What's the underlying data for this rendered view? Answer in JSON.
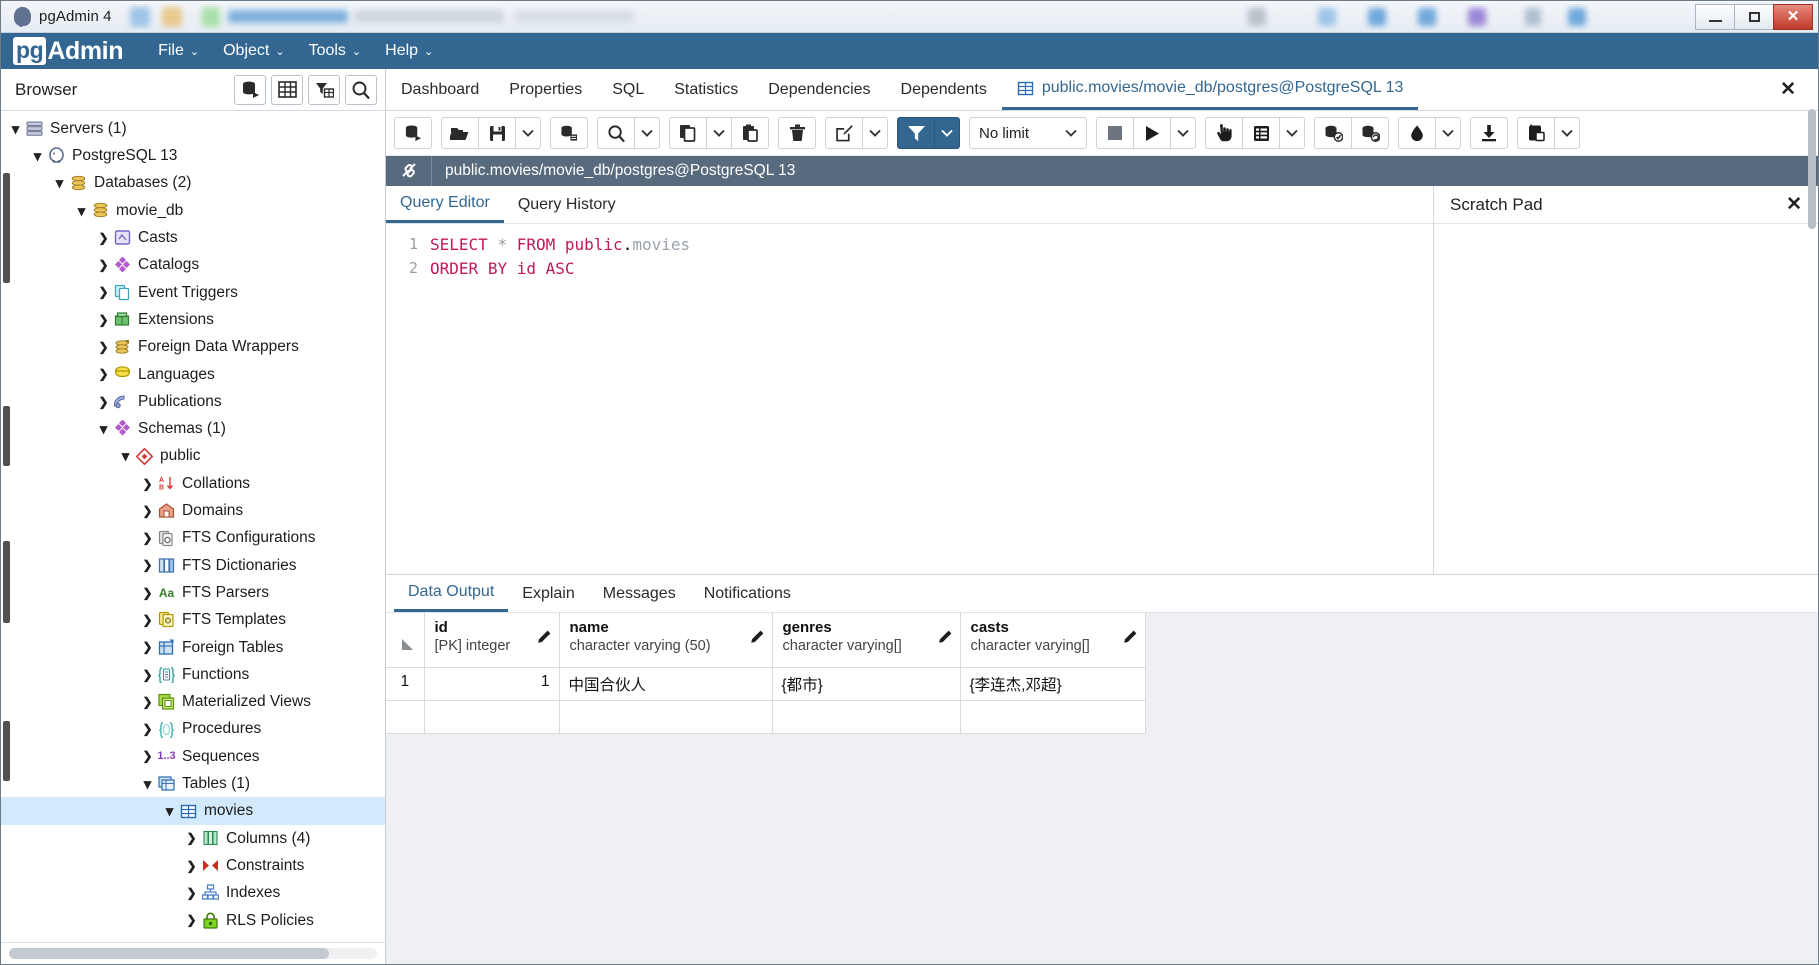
{
  "window": {
    "title": "pgAdmin 4",
    "app_icon": "postgres-elephant-icon",
    "controls": {
      "minimize": "minimize-icon",
      "maximize": "maximize-icon",
      "close": "✕"
    }
  },
  "menubar": {
    "brand_pg": "pg",
    "brand_admin": "Admin",
    "items": [
      {
        "label": "File",
        "caret": "⌄"
      },
      {
        "label": "Object",
        "caret": "⌄"
      },
      {
        "label": "Tools",
        "caret": "⌄"
      },
      {
        "label": "Help",
        "caret": "⌄"
      }
    ]
  },
  "browser": {
    "title": "Browser",
    "header_buttons": [
      {
        "name": "object-explorer-button",
        "icon": "database-run-icon"
      },
      {
        "name": "grid-view-button",
        "icon": "table-icon"
      },
      {
        "name": "filtered-rows-button",
        "icon": "filter-table-icon"
      },
      {
        "name": "search-objects-button",
        "icon": "search-icon"
      }
    ],
    "tree": [
      {
        "label": "Servers (1)",
        "indent": 0,
        "state": "down",
        "icon": "servers-icon",
        "selected": false
      },
      {
        "label": "PostgreSQL 13",
        "indent": 1,
        "state": "down",
        "icon": "postgres-icon",
        "selected": false
      },
      {
        "label": "Databases (2)",
        "indent": 2,
        "state": "down",
        "icon": "databases-icon",
        "selected": false
      },
      {
        "label": "movie_db",
        "indent": 3,
        "state": "down",
        "icon": "database-icon",
        "selected": false
      },
      {
        "label": "Casts",
        "indent": 4,
        "state": "right",
        "icon": "casts-icon",
        "selected": false
      },
      {
        "label": "Catalogs",
        "indent": 4,
        "state": "right",
        "icon": "catalogs-icon",
        "selected": false
      },
      {
        "label": "Event Triggers",
        "indent": 4,
        "state": "right",
        "icon": "event-triggers-icon",
        "selected": false
      },
      {
        "label": "Extensions",
        "indent": 4,
        "state": "right",
        "icon": "extensions-icon",
        "selected": false
      },
      {
        "label": "Foreign Data Wrappers",
        "indent": 4,
        "state": "right",
        "icon": "fdw-icon",
        "selected": false
      },
      {
        "label": "Languages",
        "indent": 4,
        "state": "right",
        "icon": "languages-icon",
        "selected": false
      },
      {
        "label": "Publications",
        "indent": 4,
        "state": "right",
        "icon": "publications-icon",
        "selected": false
      },
      {
        "label": "Schemas (1)",
        "indent": 4,
        "state": "down",
        "icon": "schemas-icon",
        "selected": false
      },
      {
        "label": "public",
        "indent": 5,
        "state": "down",
        "icon": "schema-icon",
        "selected": false
      },
      {
        "label": "Collations",
        "indent": 6,
        "state": "right",
        "icon": "collations-icon",
        "selected": false
      },
      {
        "label": "Domains",
        "indent": 6,
        "state": "right",
        "icon": "domains-icon",
        "selected": false
      },
      {
        "label": "FTS Configurations",
        "indent": 6,
        "state": "right",
        "icon": "fts-config-icon",
        "selected": false
      },
      {
        "label": "FTS Dictionaries",
        "indent": 6,
        "state": "right",
        "icon": "fts-dict-icon",
        "selected": false
      },
      {
        "label": "FTS Parsers",
        "indent": 6,
        "state": "right",
        "icon": "fts-parsers-icon",
        "selected": false
      },
      {
        "label": "FTS Templates",
        "indent": 6,
        "state": "right",
        "icon": "fts-templates-icon",
        "selected": false
      },
      {
        "label": "Foreign Tables",
        "indent": 6,
        "state": "right",
        "icon": "foreign-tables-icon",
        "selected": false
      },
      {
        "label": "Functions",
        "indent": 6,
        "state": "right",
        "icon": "functions-icon",
        "selected": false
      },
      {
        "label": "Materialized Views",
        "indent": 6,
        "state": "right",
        "icon": "matviews-icon",
        "selected": false
      },
      {
        "label": "Procedures",
        "indent": 6,
        "state": "right",
        "icon": "procedures-icon",
        "selected": false
      },
      {
        "label": "Sequences",
        "indent": 6,
        "state": "right",
        "icon": "sequences-icon",
        "selected": false
      },
      {
        "label": "Tables (1)",
        "indent": 6,
        "state": "down",
        "icon": "tables-icon",
        "selected": false
      },
      {
        "label": "movies",
        "indent": 7,
        "state": "down",
        "icon": "table-icon",
        "selected": true
      },
      {
        "label": "Columns (4)",
        "indent": 8,
        "state": "right",
        "icon": "columns-icon",
        "selected": false
      },
      {
        "label": "Constraints",
        "indent": 8,
        "state": "right",
        "icon": "constraints-icon",
        "selected": false
      },
      {
        "label": "Indexes",
        "indent": 8,
        "state": "right",
        "icon": "indexes-icon",
        "selected": false
      },
      {
        "label": "RLS Policies",
        "indent": 8,
        "state": "right",
        "icon": "rls-policies-icon",
        "selected": false
      }
    ]
  },
  "main_tabs": [
    {
      "label": "Dashboard",
      "active": false,
      "icon": null
    },
    {
      "label": "Properties",
      "active": false,
      "icon": null
    },
    {
      "label": "SQL",
      "active": false,
      "icon": null
    },
    {
      "label": "Statistics",
      "active": false,
      "icon": null
    },
    {
      "label": "Dependencies",
      "active": false,
      "icon": null
    },
    {
      "label": "Dependents",
      "active": false,
      "icon": null
    },
    {
      "label": "public.movies/movie_db/postgres@PostgreSQL 13",
      "active": true,
      "icon": "table-icon"
    }
  ],
  "tab_close_label": "✕",
  "query_toolbar": {
    "groups": [
      [
        {
          "name": "open-new-query-tool-button",
          "icon": "database-run-icon",
          "caret": false
        }
      ],
      [
        {
          "name": "open-file-button",
          "icon": "folder-open-icon",
          "caret": false
        },
        {
          "name": "save-file-button",
          "icon": "save-icon",
          "caret": false
        },
        {
          "name": "save-file-menu-button",
          "icon": "chevron-down-icon",
          "caret": true
        }
      ],
      [
        {
          "name": "edit-data-button",
          "icon": "database-edit-icon",
          "caret": false
        }
      ],
      [
        {
          "name": "find-button",
          "icon": "search-icon",
          "caret": false
        },
        {
          "name": "find-menu-button",
          "icon": "chevron-down-icon",
          "caret": true
        }
      ],
      [
        {
          "name": "copy-button",
          "icon": "copy-icon",
          "caret": false
        },
        {
          "name": "copy-menu-button",
          "icon": "chevron-down-icon",
          "caret": true
        },
        {
          "name": "paste-button",
          "icon": "paste-icon",
          "caret": false
        }
      ],
      [
        {
          "name": "delete-row-button",
          "icon": "trash-icon",
          "caret": false
        }
      ],
      [
        {
          "name": "edit-menu-button",
          "icon": "pencil-square-icon",
          "caret": false
        },
        {
          "name": "edit-menu-caret-button",
          "icon": "chevron-down-icon",
          "caret": true
        }
      ],
      [
        {
          "name": "filter-button",
          "icon": "filter-icon",
          "caret": false,
          "accent": true
        },
        {
          "name": "filter-menu-button",
          "icon": "chevron-down-icon",
          "caret": true,
          "accent": true
        }
      ]
    ],
    "row_limit": {
      "value": "No limit",
      "caret": "⌄"
    },
    "exec_groups": [
      [
        {
          "name": "stop-query-button",
          "icon": "stop-square-icon",
          "caret": false
        },
        {
          "name": "execute-query-button",
          "icon": "play-icon",
          "caret": false
        },
        {
          "name": "execute-menu-button",
          "icon": "chevron-down-icon",
          "caret": true
        }
      ],
      [
        {
          "name": "explain-button",
          "icon": "hand-pointer-icon",
          "caret": false
        },
        {
          "name": "explain-analyze-button",
          "icon": "list-icon",
          "caret": false
        },
        {
          "name": "explain-options-button",
          "icon": "chevron-down-icon",
          "caret": true
        }
      ],
      [
        {
          "name": "commit-button",
          "icon": "commit-icon",
          "caret": false
        },
        {
          "name": "rollback-button",
          "icon": "rollback-icon",
          "caret": false
        }
      ],
      [
        {
          "name": "clear-button",
          "icon": "eraser-icon",
          "caret": false
        },
        {
          "name": "clear-menu-button",
          "icon": "chevron-down-icon",
          "caret": true
        }
      ],
      [
        {
          "name": "download-csv-button",
          "icon": "download-icon",
          "caret": false
        }
      ],
      [
        {
          "name": "macros-button",
          "icon": "macro-icon",
          "caret": false
        },
        {
          "name": "macros-menu-button",
          "icon": "chevron-down-icon",
          "caret": true
        }
      ]
    ]
  },
  "connection_bar": {
    "icon": "connection-icon",
    "text": "public.movies/movie_db/postgres@PostgreSQL 13"
  },
  "editor": {
    "tabs": [
      {
        "label": "Query Editor",
        "active": true
      },
      {
        "label": "Query History",
        "active": false
      }
    ],
    "lines": [
      {
        "number": "1",
        "text": "SELECT * FROM public.movies"
      },
      {
        "number": "2",
        "text": "ORDER BY id ASC"
      }
    ]
  },
  "scratch_pad": {
    "title": "Scratch Pad",
    "close": "✕"
  },
  "results": {
    "tabs": [
      {
        "label": "Data Output",
        "active": true
      },
      {
        "label": "Explain",
        "active": false
      },
      {
        "label": "Messages",
        "active": false
      },
      {
        "label": "Notifications",
        "active": false
      }
    ],
    "columns": [
      {
        "name": "id",
        "type": "[PK] integer",
        "edit_icon": "pencil-icon"
      },
      {
        "name": "name",
        "type": "character varying (50)",
        "edit_icon": "pencil-icon"
      },
      {
        "name": "genres",
        "type": "character varying[]",
        "edit_icon": "pencil-icon"
      },
      {
        "name": "casts",
        "type": "character varying[]",
        "edit_icon": "pencil-icon"
      }
    ],
    "rows": [
      {
        "rownum": "1",
        "id": "1",
        "name": "中国合伙人",
        "genres": "{都市}",
        "casts": "{李连杰,邓超}"
      }
    ]
  },
  "colors": {
    "brand": "#336791",
    "connbar": "#586a7d",
    "selection": "#d3eafd",
    "keyword": "#c2185b",
    "close_red": "#c0392b"
  }
}
